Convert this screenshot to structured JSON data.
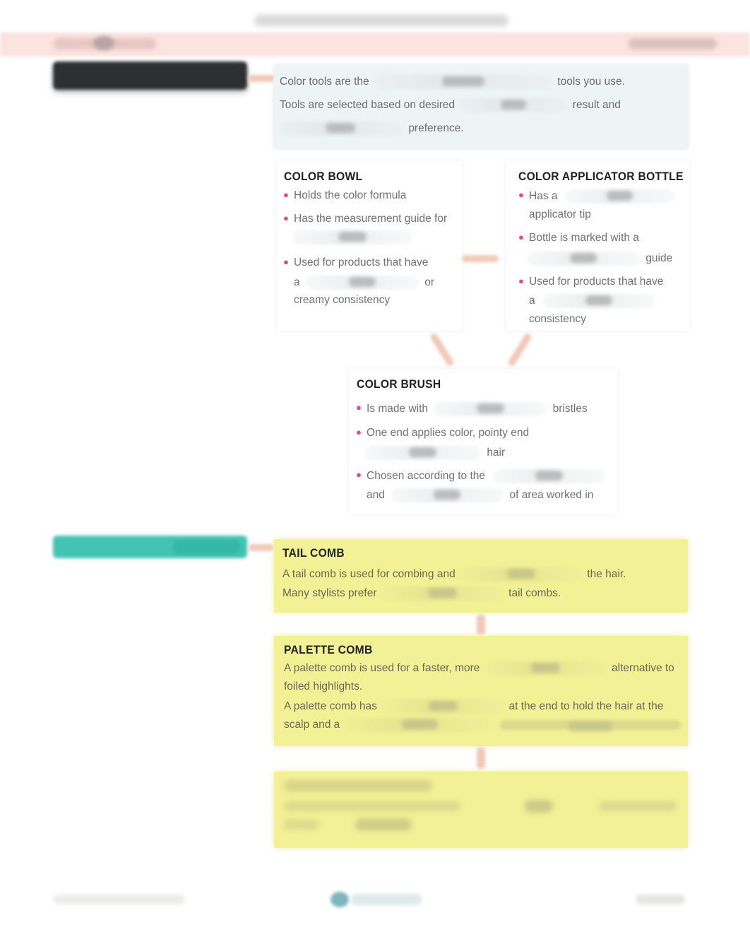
{
  "header": {
    "title_redacted": true,
    "chapter_band_left_redacted": true,
    "chapter_band_right_redacted": true
  },
  "side_labels": [
    {
      "id": "color-tools-label",
      "color": "#2d2f31",
      "redacted": true
    },
    {
      "id": "combs-label",
      "color": "#43c3b2",
      "redacted": true
    }
  ],
  "intro": {
    "line1": {
      "before": "Color tools are the",
      "after": "tools you use."
    },
    "line2": {
      "before": "Tools are selected based on desired",
      "after": "result and"
    },
    "line3": {
      "before": "",
      "after": "preference."
    }
  },
  "color_bowl": {
    "title": "COLOR BOWL",
    "bullets": [
      {
        "lines": [
          "Holds the color formula"
        ]
      },
      {
        "lines": [
          "Has the measurement guide for",
          ""
        ]
      },
      {
        "lines": [
          "Used for products that have",
          "a",
          "or",
          "creamy consistency"
        ]
      }
    ]
  },
  "applicator_bottle": {
    "title": "COLOR APPLICATOR BOTTLE",
    "bullets": [
      {
        "lines": [
          "Has a",
          "applicator tip"
        ]
      },
      {
        "lines": [
          "Bottle is marked with a",
          "guide"
        ]
      },
      {
        "lines": [
          "Used for products that have",
          "a",
          "consistency"
        ]
      }
    ]
  },
  "color_brush": {
    "title": "COLOR BRUSH",
    "bullets": [
      {
        "lines": [
          "Is made with",
          "bristles"
        ]
      },
      {
        "lines": [
          "One end applies color, pointy end",
          "hair"
        ]
      },
      {
        "lines": [
          "Chosen according to the",
          "and",
          "of area worked in"
        ]
      }
    ]
  },
  "tail_comb": {
    "title": "TAIL COMB",
    "line1": {
      "before": "A tail comb is used for combing and",
      "after": "the hair."
    },
    "line2": {
      "before": "Many stylists prefer",
      "after": "tail combs."
    }
  },
  "palette_comb": {
    "title": "PALETTE COMB",
    "line1": {
      "before": "A palette comb is used for a faster, more",
      "after": "alternative to"
    },
    "line2": "foiled highlights.",
    "line3": {
      "before": "A palette comb has",
      "after": "at the end to hold the hair at the"
    },
    "line4": {
      "before": "scalp and a"
    }
  },
  "third_card": {
    "redacted": true
  },
  "footer": {
    "redacted": true
  },
  "colors": {
    "bullet": "#e5468d",
    "intro_bg": "#eef4f5",
    "comb_card_bg": "#f3f196",
    "connector": "#f0c8b8",
    "teal_label": "#43c3b2",
    "dark_label": "#2d2f31",
    "band": "#fbe3e0"
  }
}
